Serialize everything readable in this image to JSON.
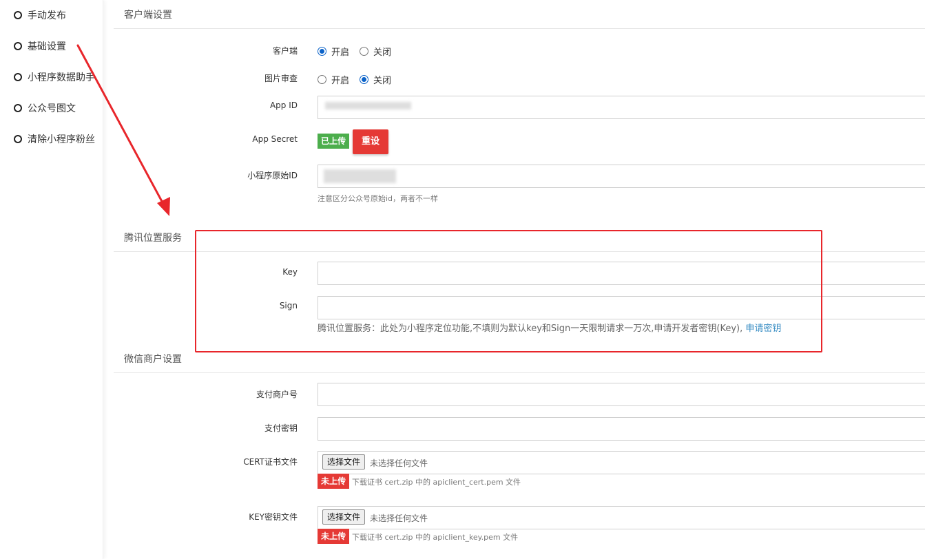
{
  "sidebar": {
    "items": [
      {
        "label": "手动发布"
      },
      {
        "label": "基础设置"
      },
      {
        "label": "小程序数据助手"
      },
      {
        "label": "公众号图文"
      },
      {
        "label": "清除小程序粉丝"
      }
    ]
  },
  "client_section": {
    "title": "客户端设置",
    "client": {
      "label": "客户端",
      "options": [
        "开启",
        "关闭"
      ],
      "selected": "开启"
    },
    "image_review": {
      "label": "图片审查",
      "options": [
        "开启",
        "关闭"
      ],
      "selected": "关闭"
    },
    "app_id": {
      "label": "App ID",
      "value": ""
    },
    "app_secret": {
      "label": "App Secret",
      "status": "已上传",
      "reset_label": "重设"
    },
    "original_id": {
      "label": "小程序原始ID",
      "value": "",
      "hint": "注意区分公众号原始id，两者不一样"
    }
  },
  "tencent_section": {
    "title": "腾讯位置服务",
    "key": {
      "label": "Key",
      "value": ""
    },
    "sign": {
      "label": "Sign",
      "value": ""
    },
    "hint": "腾讯位置服务：此处为小程序定位功能,不填则为默认key和Sign一天限制请求一万次,申请开发者密钥(Key),",
    "link": "申请密钥"
  },
  "wechat_section": {
    "title": "微信商户设置",
    "merchant_no": {
      "label": "支付商户号",
      "value": ""
    },
    "pay_key": {
      "label": "支付密钥",
      "value": ""
    },
    "cert_file": {
      "label": "CERT证书文件",
      "button": "选择文件",
      "file_status": "未选择任何文件",
      "upload_status": "未上传",
      "hint": "下载证书 cert.zip 中的 apiclient_cert.pem 文件"
    },
    "key_file": {
      "label": "KEY密钥文件",
      "button": "选择文件",
      "file_status": "未选择任何文件",
      "upload_status": "未上传",
      "hint": "下载证书 cert.zip 中的 apiclient_key.pem 文件"
    }
  },
  "colors": {
    "accent_blue": "#0b62c8",
    "success_green": "#4cae4c",
    "danger_red": "#e53935",
    "annotation_red": "#e8262b",
    "link_blue": "#3a8ec4"
  }
}
